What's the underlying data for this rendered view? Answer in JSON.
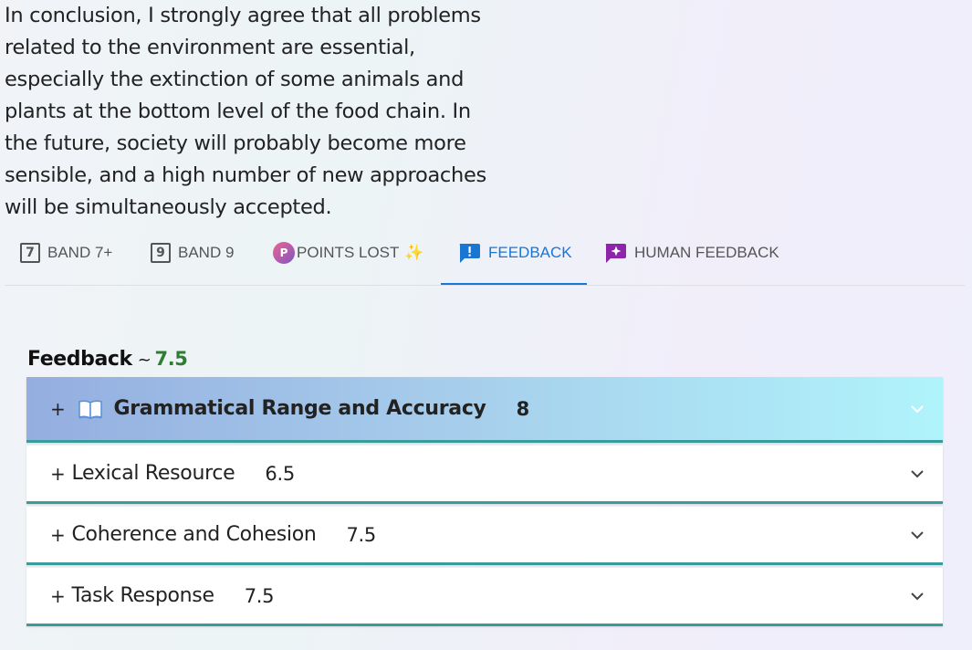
{
  "essay": {
    "lines": [
      "In conclusion, I strongly agree that all problems",
      "related to the environment are essential,",
      "especially the extinction of some animals and",
      "plants at the bottom level of the food chain. In",
      "the future, society will probably become more",
      "sensible, and a high number of new approaches",
      "will be simultaneously accepted."
    ]
  },
  "tabs": [
    {
      "label": "BAND 7+",
      "icon_text": "7",
      "icon": "band-7-icon"
    },
    {
      "label": "BAND 9",
      "icon_text": "9",
      "icon": "band-9-icon"
    },
    {
      "label": "POINTS LOST",
      "icon_text": "P",
      "icon": "points-lost-icon",
      "suffix": "✨"
    },
    {
      "label": "FEEDBACK",
      "icon": "feedback-icon",
      "active": true
    },
    {
      "label": "HUMAN FEEDBACK",
      "icon": "human-feedback-icon"
    }
  ],
  "feedback": {
    "title": "Feedback",
    "separator": "~",
    "overall_score": "7.5",
    "score_color": "#2e7d32",
    "criteria": [
      {
        "plus": "+",
        "name": "Grammatical Range and Accuracy",
        "score": "8",
        "expanded": true,
        "icon": "book-icon"
      },
      {
        "plus": "+",
        "name": "Lexical Resource",
        "score": "6.5",
        "expanded": false
      },
      {
        "plus": "+",
        "name": "Coherence and Cohesion",
        "score": "7.5",
        "expanded": false
      },
      {
        "plus": "+",
        "name": "Task Response",
        "score": "7.5",
        "expanded": false
      }
    ]
  },
  "colors": {
    "accent": "#1976d2",
    "accordion_border": "#3a9c9a",
    "human_feedback_icon": "#8e24aa"
  }
}
